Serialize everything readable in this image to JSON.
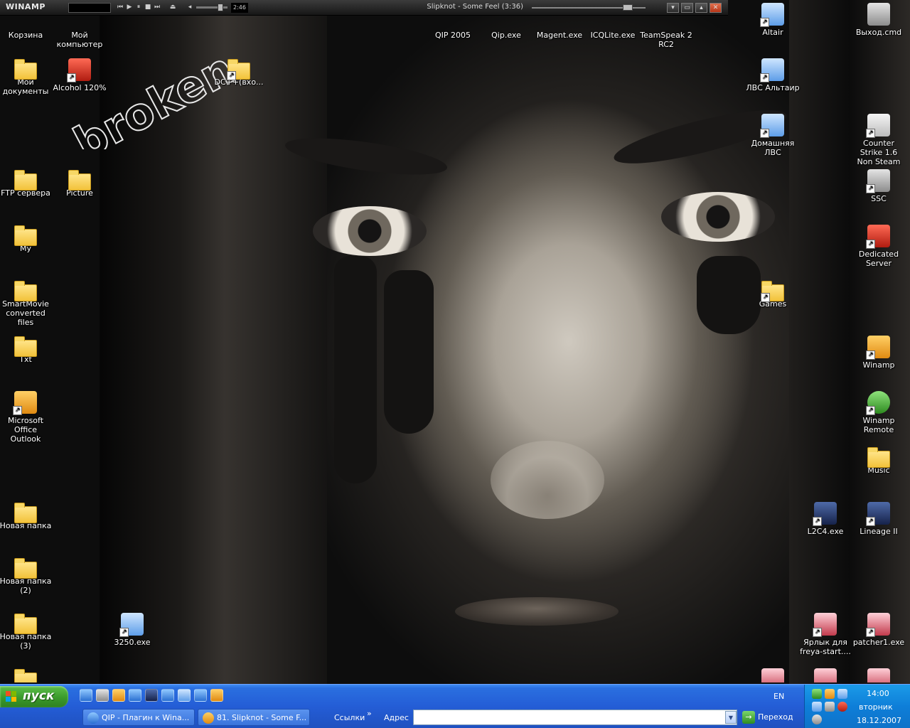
{
  "winamp": {
    "brand": "WINAMP",
    "track_title": "Slipknot - Some Feel (3:36)",
    "time": "2:46"
  },
  "wallpaper_text": "...broken...",
  "desktop_icons": {
    "recycle_bin": "Корзина",
    "my_computer": "Мой компьютер",
    "my_documents": "Мои документы",
    "alcohol": "Alcohol 120%",
    "dcpp": "DC++(вхо...",
    "ftp": "FTP сервера",
    "picture": "Picture",
    "my": "My",
    "smartmovie": "SmartMovie converted files",
    "txt": "Txt",
    "outlook": "Microsoft Office Outlook",
    "new_folder": "Новая папка",
    "new_folder_2": "Новая папка (2)",
    "new_folder_3": "Новая папка (3)",
    "exe_3250": "3250.exe",
    "qip2005": "QIP 2005",
    "qip_exe": "Qip.exe",
    "magent": "Magent.exe",
    "icqlite": "ICQLite.exe",
    "teamspeak": "TeamSpeak 2 RC2",
    "altair": "Altair",
    "lan_altair": "ЛВС Альтаир",
    "home_lan": "Домашняя ЛВС",
    "games": "Games",
    "exit_cmd": "Выход.cmd",
    "counter_strike": "Counter Strike 1.6 Non Steam",
    "ssc": "SSC",
    "dedicated_server": "Dedicated Server",
    "winamp": "Winamp",
    "winamp_remote": "Winamp Remote",
    "music": "Music",
    "l2c4": "L2C4.exe",
    "lineage2": "Lineage II",
    "freya": "Ярлык для freya-start....",
    "patcher": "patcher1.exe"
  },
  "taskbar": {
    "start_label": "пуск",
    "lang": "EN",
    "tasks": [
      {
        "label": "QIP - Плагин к Wina..."
      },
      {
        "label": "81. Slipknot - Some F..."
      }
    ],
    "links_label": "Ссылки",
    "links_chevron": "»",
    "address_label": "Адрес",
    "address_value": "",
    "go_label": "Переход",
    "clock_time": "14:00",
    "clock_day": "вторник",
    "clock_date": "18.12.2007"
  }
}
